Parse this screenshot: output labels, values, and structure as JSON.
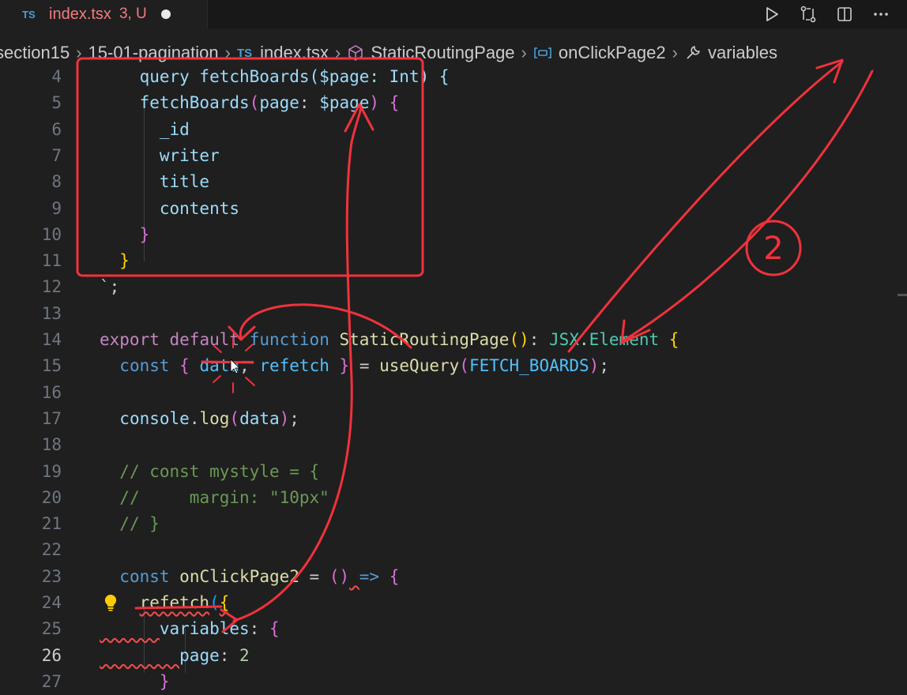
{
  "tab": {
    "lang": "TS",
    "filename": "index.tsx",
    "badge": "3, U"
  },
  "breadcrumb": [
    {
      "label": "section15",
      "icon": ""
    },
    {
      "label": "15-01-pagination",
      "icon": ""
    },
    {
      "label": "index.tsx",
      "icon": "ts-file-icon",
      "prefix": "TS"
    },
    {
      "label": "StaticRoutingPage",
      "icon": "cube-icon"
    },
    {
      "label": "onClickPage2",
      "icon": "variable-icon"
    },
    {
      "label": "variables",
      "icon": "wrench-icon"
    }
  ],
  "lines": [
    {
      "n": "4",
      "tokens": [
        [
          "    ",
          ""
        ],
        [
          "query fetchBoards($page: Int) {",
          "vr"
        ]
      ]
    },
    {
      "n": "5",
      "tokens": [
        [
          "    ",
          ""
        ],
        [
          "fetchBoards",
          "vr"
        ],
        [
          "(",
          "b2"
        ],
        [
          "page",
          "vr"
        ],
        [
          ": ",
          "pu"
        ],
        [
          "$page",
          "vr"
        ],
        [
          ")",
          "b2"
        ],
        [
          " ",
          ""
        ],
        [
          "{",
          "b2"
        ]
      ]
    },
    {
      "n": "6",
      "tokens": [
        [
          "      ",
          ""
        ],
        [
          "_id",
          "vr"
        ]
      ]
    },
    {
      "n": "7",
      "tokens": [
        [
          "      ",
          ""
        ],
        [
          "writer",
          "vr"
        ]
      ]
    },
    {
      "n": "8",
      "tokens": [
        [
          "      ",
          ""
        ],
        [
          "title",
          "vr"
        ]
      ]
    },
    {
      "n": "9",
      "tokens": [
        [
          "      ",
          ""
        ],
        [
          "contents",
          "vr"
        ]
      ]
    },
    {
      "n": "10",
      "tokens": [
        [
          "    ",
          ""
        ],
        [
          "}",
          "b2"
        ]
      ]
    },
    {
      "n": "11",
      "tokens": [
        [
          "  ",
          ""
        ],
        [
          "}",
          "b1"
        ]
      ]
    },
    {
      "n": "12",
      "tokens": [
        [
          "`;",
          "pu"
        ]
      ]
    },
    {
      "n": "13",
      "tokens": []
    },
    {
      "n": "14",
      "tokens": [
        [
          "export",
          "kw"
        ],
        [
          " ",
          ""
        ],
        [
          "default",
          "kw"
        ],
        [
          " ",
          ""
        ],
        [
          "function",
          "kwb"
        ],
        [
          " ",
          ""
        ],
        [
          "StaticRoutingPage",
          "fn"
        ],
        [
          "()",
          "b1"
        ],
        [
          ": ",
          "pu"
        ],
        [
          "JSX",
          "ty"
        ],
        [
          ".",
          "pu"
        ],
        [
          "Element",
          "ty"
        ],
        [
          " ",
          ""
        ],
        [
          "{",
          "b1"
        ]
      ]
    },
    {
      "n": "15",
      "tokens": [
        [
          "  ",
          ""
        ],
        [
          "const",
          "kwb"
        ],
        [
          " ",
          ""
        ],
        [
          "{",
          "b2"
        ],
        [
          " ",
          ""
        ],
        [
          "data",
          "cn"
        ],
        [
          ", ",
          "pu"
        ],
        [
          "refetch",
          "cn"
        ],
        [
          " ",
          ""
        ],
        [
          "}",
          "b2"
        ],
        [
          " = ",
          "pu"
        ],
        [
          "useQuery",
          "fn"
        ],
        [
          "(",
          "b2"
        ],
        [
          "FETCH_BOARDS",
          "cn"
        ],
        [
          ")",
          "b2"
        ],
        [
          ";",
          "pu"
        ]
      ]
    },
    {
      "n": "16",
      "tokens": []
    },
    {
      "n": "17",
      "tokens": [
        [
          "  ",
          ""
        ],
        [
          "console",
          "vr"
        ],
        [
          ".",
          "pu"
        ],
        [
          "log",
          "fn"
        ],
        [
          "(",
          "b2"
        ],
        [
          "data",
          "vr"
        ],
        [
          ")",
          "b2"
        ],
        [
          ";",
          "pu"
        ]
      ]
    },
    {
      "n": "18",
      "tokens": []
    },
    {
      "n": "19",
      "tokens": [
        [
          "  ",
          ""
        ],
        [
          "// const mystyle = {",
          "cm"
        ]
      ]
    },
    {
      "n": "20",
      "tokens": [
        [
          "  ",
          ""
        ],
        [
          "//     margin: \"10px\"",
          "cm"
        ]
      ]
    },
    {
      "n": "21",
      "tokens": [
        [
          "  ",
          ""
        ],
        [
          "// }",
          "cm"
        ]
      ]
    },
    {
      "n": "22",
      "tokens": []
    },
    {
      "n": "23",
      "tokens": [
        [
          "  ",
          ""
        ],
        [
          "const",
          "kwb"
        ],
        [
          " ",
          ""
        ],
        [
          "onClickPage2",
          "fn"
        ],
        [
          " = ",
          "pu"
        ],
        [
          "()",
          "b2"
        ],
        [
          " ",
          ""
        ],
        [
          "=>",
          "kwb"
        ],
        [
          " ",
          ""
        ],
        [
          "{",
          "b2"
        ]
      ]
    },
    {
      "n": "24",
      "tokens": [
        [
          "    ",
          ""
        ],
        [
          "refetch",
          "fn"
        ],
        [
          "(",
          "b3"
        ],
        [
          "{",
          "b1"
        ]
      ]
    },
    {
      "n": "25",
      "tokens": [
        [
          "      ",
          ""
        ],
        [
          "variables",
          "vr"
        ],
        [
          ": ",
          "pu"
        ],
        [
          "{",
          "b2"
        ]
      ]
    },
    {
      "n": "26",
      "tokens": [
        [
          "        ",
          ""
        ],
        [
          "page",
          "vr"
        ],
        [
          ": ",
          "pu"
        ],
        [
          "2",
          "nm"
        ]
      ],
      "active": true
    },
    {
      "n": "27",
      "tokens": [
        [
          "      ",
          ""
        ],
        [
          "}",
          "b2"
        ]
      ]
    }
  ],
  "annotations": {
    "number_label": "2"
  },
  "colors": {
    "annotation": "#f0323c",
    "background": "#1f1f1f"
  }
}
